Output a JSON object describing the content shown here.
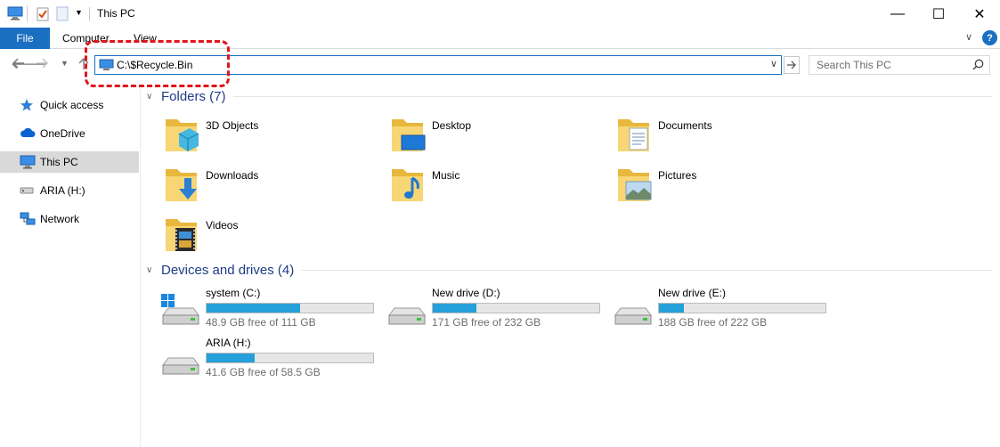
{
  "window": {
    "title": "This PC",
    "minimize_glyph": "—",
    "maximize_glyph": "☐",
    "close_glyph": "✕"
  },
  "ribbon": {
    "tabs": [
      "File",
      "Computer",
      "View"
    ],
    "collapse_glyph": "∨",
    "help_glyph": "?"
  },
  "address": {
    "value": "C:\\$Recycle.Bin",
    "icon": "computer-icon"
  },
  "search": {
    "placeholder": "Search This PC"
  },
  "sidebar": {
    "items": [
      {
        "label": "Quick access",
        "icon": "star-icon"
      },
      {
        "label": "OneDrive",
        "icon": "cloud-icon"
      },
      {
        "label": "This PC",
        "icon": "computer-icon",
        "selected": true
      },
      {
        "label": "ARIA (H:)",
        "icon": "drive-icon"
      },
      {
        "label": "Network",
        "icon": "network-icon"
      }
    ]
  },
  "folders": {
    "title": "Folders (7)",
    "items": [
      {
        "label": "3D Objects",
        "icon": "3d-objects-folder-icon"
      },
      {
        "label": "Desktop",
        "icon": "desktop-folder-icon"
      },
      {
        "label": "Documents",
        "icon": "documents-folder-icon"
      },
      {
        "label": "Downloads",
        "icon": "downloads-folder-icon"
      },
      {
        "label": "Music",
        "icon": "music-folder-icon"
      },
      {
        "label": "Pictures",
        "icon": "pictures-folder-icon"
      },
      {
        "label": "Videos",
        "icon": "videos-folder-icon"
      }
    ]
  },
  "drives": {
    "title": "Devices and drives (4)",
    "items": [
      {
        "name": "system (C:)",
        "free_text": "48.9 GB free of 111 GB",
        "used_fraction": 0.56,
        "icon": "windows-drive-icon"
      },
      {
        "name": "New drive (D:)",
        "free_text": "171 GB free of 232 GB",
        "used_fraction": 0.26,
        "icon": "drive-icon"
      },
      {
        "name": "New drive (E:)",
        "free_text": "188 GB free of 222 GB",
        "used_fraction": 0.15,
        "icon": "drive-icon"
      },
      {
        "name": "ARIA (H:)",
        "free_text": "41.6 GB free of 58.5 GB",
        "used_fraction": 0.29,
        "icon": "drive-icon"
      }
    ]
  },
  "colors": {
    "accent": "#1a6fc0",
    "drive_bar": "#26a0da",
    "group_title": "#1e3c87",
    "highlight": "#e1141a"
  }
}
